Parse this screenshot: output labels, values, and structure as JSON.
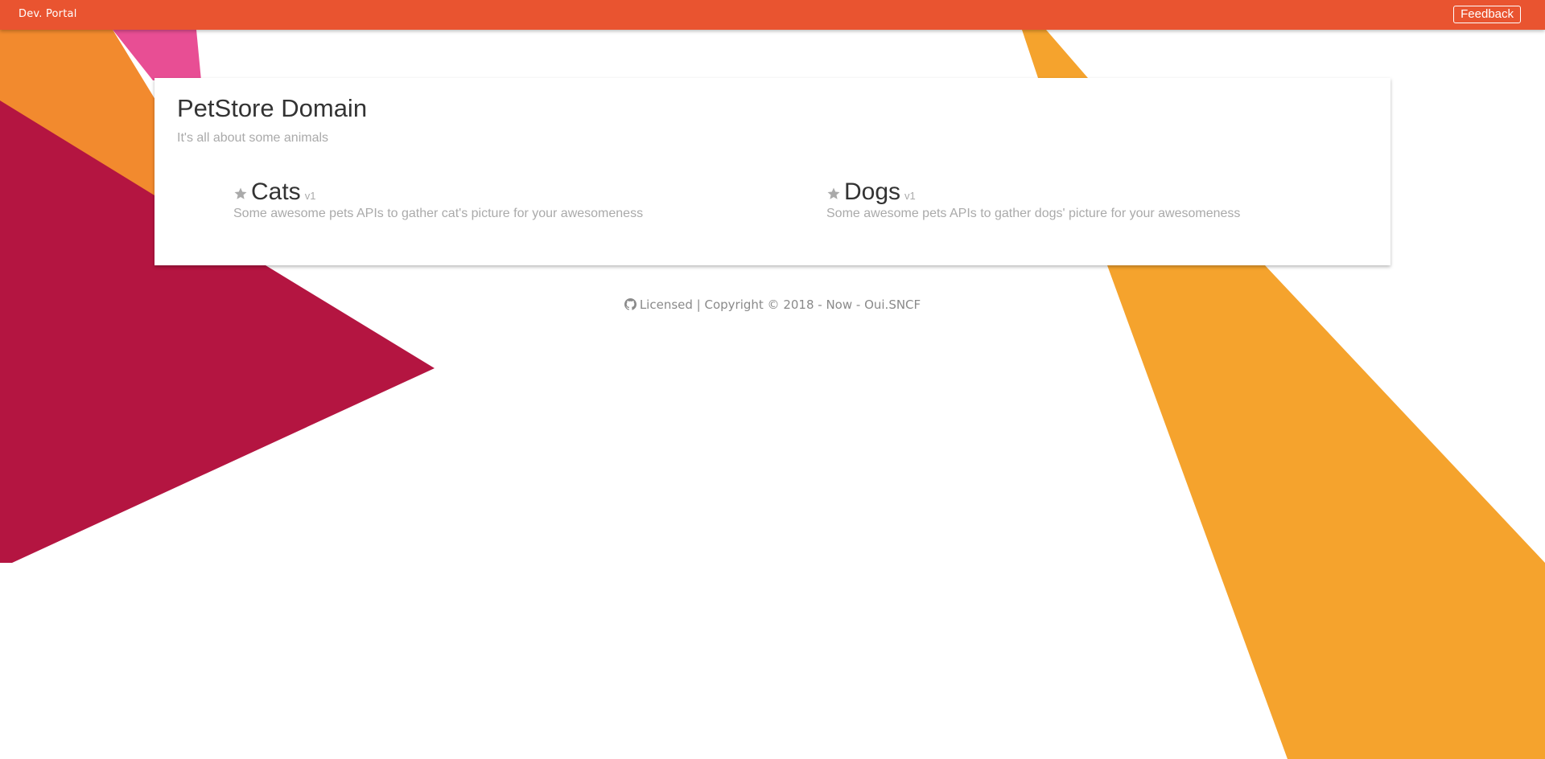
{
  "header": {
    "brand": "Dev. Portal",
    "feedback_label": "Feedback"
  },
  "domain": {
    "title": "PetStore Domain",
    "subtitle": "It's all about some animals"
  },
  "apis": [
    {
      "name": "Cats",
      "version": "v1",
      "description": "Some awesome pets APIs to gather cat's picture for your awesomeness",
      "icon": "star-icon"
    },
    {
      "name": "Dogs",
      "version": "v1",
      "description": "Some awesome pets APIs to gather dogs' picture for your awesomeness",
      "icon": "star-icon"
    }
  ],
  "footer": {
    "icon": "github-icon",
    "licensed": "Licensed",
    "separator": " | ",
    "copyright": "Copyright © 2018 - Now - Oui.SNCF"
  },
  "colors": {
    "topbar": "#e95430",
    "orange": "#f39c2d",
    "crimson": "#b41541",
    "pink": "#e84e94",
    "amber": "#f5a32d"
  }
}
